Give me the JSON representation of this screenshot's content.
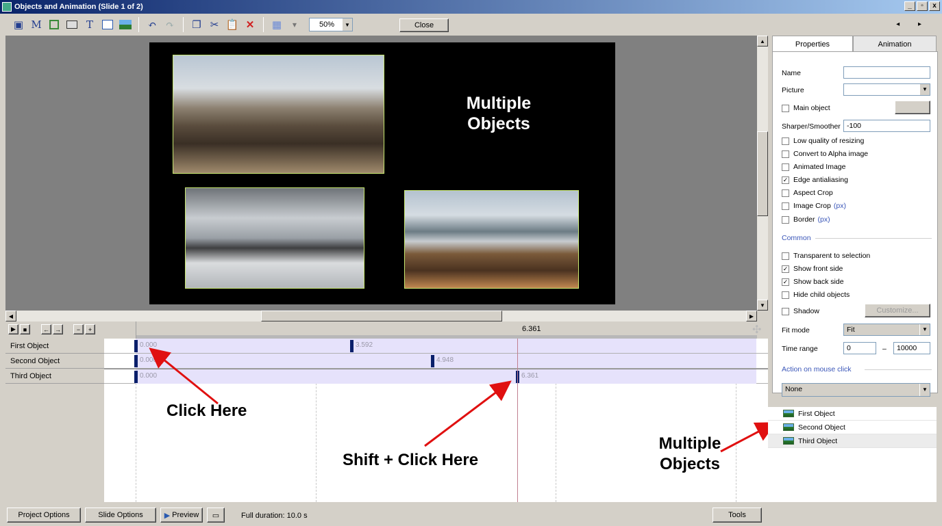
{
  "window": {
    "title": "Objects and Animation (Slide 1 of 2)",
    "controls": [
      "_",
      "▫",
      "x"
    ]
  },
  "toolbar": {
    "zoom": "50%",
    "close_label": "Close",
    "nav": "◂ ▸",
    "icons": [
      "camera-icon",
      "mask-icon",
      "frame-icon",
      "button-icon",
      "text-icon",
      "rectangle-icon",
      "image-icon",
      "undo-icon",
      "redo-icon",
      "copy-icon",
      "cut-icon",
      "paste-icon",
      "delete-icon",
      "grid-icon"
    ]
  },
  "slide": {
    "title_line1": "Multiple",
    "title_line2": "Objects"
  },
  "timeline": {
    "ruler_label": "6.361",
    "rows": [
      {
        "label": "First Object",
        "kf": [
          {
            "value": "0.000"
          },
          {
            "value": "3.592"
          }
        ]
      },
      {
        "label": "Second Object",
        "kf": [
          {
            "value": "0.000"
          },
          {
            "value": "4.948"
          }
        ]
      },
      {
        "label": "Third Object",
        "kf": [
          {
            "value": "0.000"
          },
          {
            "value": "6.361"
          }
        ]
      }
    ]
  },
  "annotations": {
    "click_here": "Click Here",
    "shift_click": "Shift + Click Here",
    "multiple_line1": "Multiple",
    "multiple_line2": "Objects"
  },
  "panel": {
    "tabs": {
      "properties": "Properties",
      "animation": "Animation"
    },
    "name_label": "Name",
    "name_value": "",
    "picture_label": "Picture",
    "picture_value": "",
    "main_object": "Main object",
    "sharper_label": "Sharper/Smoother",
    "sharper_value": "-100",
    "checkboxes": [
      {
        "label": "Low quality of resizing",
        "checked": false
      },
      {
        "label": "Convert to Alpha image",
        "checked": false
      },
      {
        "label": "Animated Image",
        "checked": false
      },
      {
        "label": "Edge antialiasing",
        "checked": true
      },
      {
        "label": "Aspect Crop",
        "checked": false
      }
    ],
    "image_crop": "Image Crop",
    "border": "Border",
    "px": "(px)",
    "common": "Common",
    "common_checks": [
      {
        "label": "Transparent to selection",
        "checked": false
      },
      {
        "label": "Show front side",
        "checked": true
      },
      {
        "label": "Show back side",
        "checked": true
      },
      {
        "label": "Hide child objects",
        "checked": false
      }
    ],
    "shadow": "Shadow",
    "customize": "Customize...",
    "fit_mode_label": "Fit mode",
    "fit_mode_value": "Fit",
    "time_range_label": "Time range",
    "time_from": "0",
    "time_dash": "–",
    "time_to": "10000",
    "action_label": "Action on mouse click",
    "action_value": "None",
    "objects": [
      "First Object",
      "Second Object",
      "Third Object"
    ]
  },
  "bottom": {
    "project_options": "Project Options",
    "slide_options": "Slide Options",
    "preview": "Preview",
    "full_duration": "Full duration: 10.0 s",
    "tools": "Tools"
  }
}
